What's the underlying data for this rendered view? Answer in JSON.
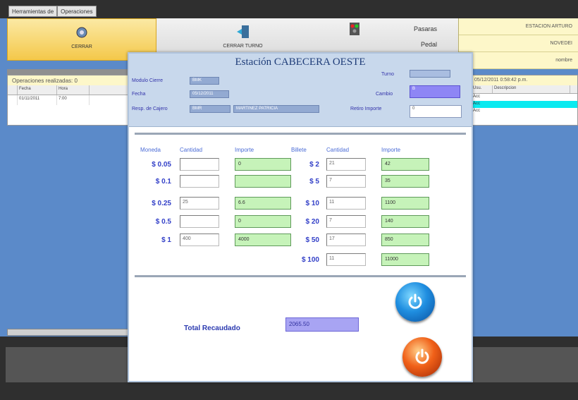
{
  "window": {
    "tabs": [
      "Herramientas de",
      "Operaciones"
    ]
  },
  "toolbar": {
    "btn1_label": "CERRAR",
    "btn2_label": "CERRAR TURNO",
    "btn3_line1": "Pasaras",
    "btn3_line2": "Pedal"
  },
  "info_right": {
    "line1": "ESTACION ARTURO",
    "line2": "NOVEDEI",
    "line3": "nombre"
  },
  "left_grid": {
    "caption": "Operaciones realizadas: 0",
    "headers": [
      "",
      "Fecha",
      "Hora"
    ],
    "rows": [
      [
        "",
        "01/11/2011",
        "7:00"
      ]
    ]
  },
  "right_grid": {
    "caption": "05/12/2011 0:58:42 p.m.",
    "headers": [
      "Usu.",
      "Descripcion"
    ],
    "rows": [
      "Acc",
      "Acc",
      "Acc"
    ]
  },
  "dialog": {
    "title": "Estación CABECERA OESTE",
    "fields": {
      "modulo_label": "Modulo Cierre",
      "modulo_value": "BMK",
      "turno_label": "Turno",
      "turno_value": "",
      "fecha_label": "Fecha",
      "fecha_value": "05/12/2011",
      "cambio_label": "Cambio",
      "cambio_value": "B",
      "resp_label": "Resp. de Cajero",
      "resp_code": "BMR",
      "resp_name": "MARTINEZ PATRICIA",
      "retiro_label": "Retiro Importe",
      "retiro_value": "0"
    },
    "headers": {
      "moneda": "Moneda",
      "cantidad1": "Cantidad",
      "importe1": "Importe",
      "billete": "Billete",
      "cantidad2": "Cantidad",
      "importe2": "Importe"
    },
    "coins": [
      {
        "denom": "$ 0.05",
        "qty": "",
        "importe": "0"
      },
      {
        "denom": "$ 0.1",
        "qty": "",
        "importe": ""
      },
      {
        "denom": "$ 0.25",
        "qty": "25",
        "importe": "6.6"
      },
      {
        "denom": "$ 0.5",
        "qty": "",
        "importe": "0"
      },
      {
        "denom": "$ 1",
        "qty": "400",
        "importe": "4000"
      }
    ],
    "bills": [
      {
        "denom": "$ 2",
        "qty": "21",
        "importe": "42"
      },
      {
        "denom": "$ 5",
        "qty": "7",
        "importe": "35"
      },
      {
        "denom": "$ 10",
        "qty": "11",
        "importe": "1100"
      },
      {
        "denom": "$ 20",
        "qty": "7",
        "importe": "140"
      },
      {
        "denom": "$ 50",
        "qty": "17",
        "importe": "850"
      },
      {
        "denom": "$ 100",
        "qty": "11",
        "importe": "11000"
      }
    ],
    "total_label": "Total Recaudado",
    "total_value": "2065.50"
  },
  "colors": {
    "accent": "#3340c8",
    "importe_bg": "#c6f3b9",
    "total_bg": "#a8a4f3",
    "selected_row": "#0aeaf0"
  },
  "icons": {
    "ok_button": "power-icon",
    "cancel_button": "power-icon"
  }
}
